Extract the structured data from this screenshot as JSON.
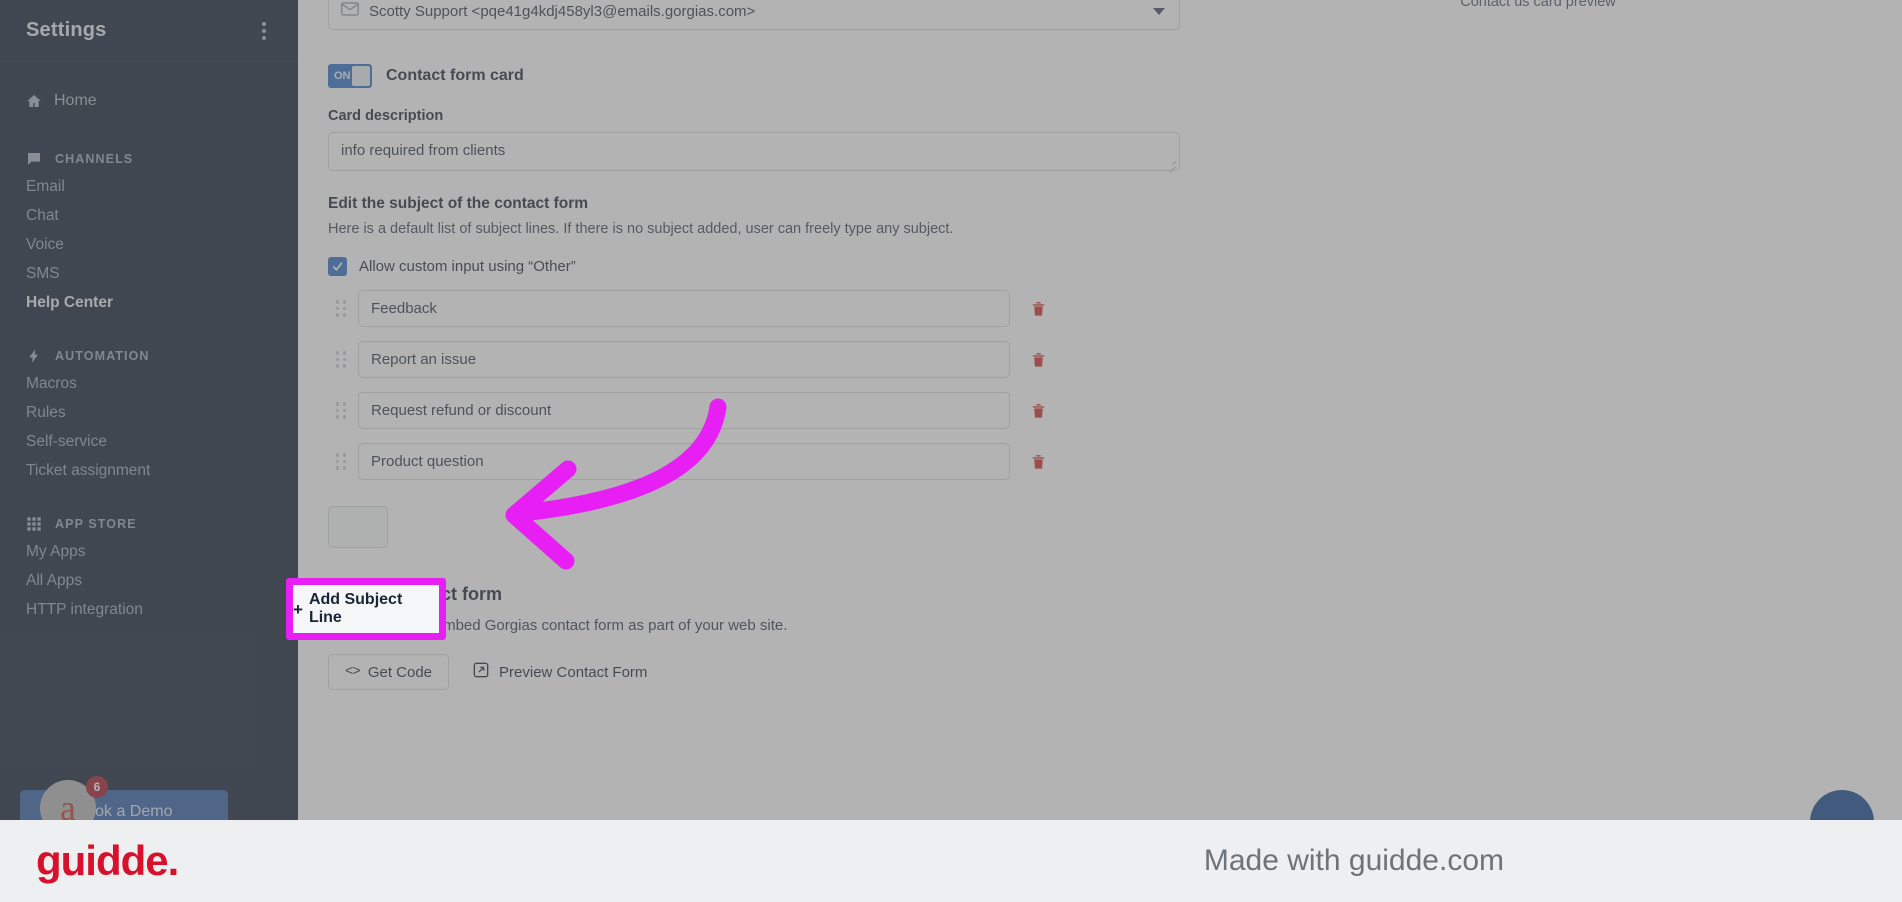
{
  "sidebar": {
    "title": "Settings",
    "menu_icon": "kebab-menu-icon",
    "home": {
      "label": "Home",
      "icon": "home-icon"
    },
    "sections": [
      {
        "label": "CHANNELS",
        "icon": "chat-bubble-icon",
        "items": [
          {
            "label": "Email",
            "active": false
          },
          {
            "label": "Chat",
            "active": false
          },
          {
            "label": "Voice",
            "active": false
          },
          {
            "label": "SMS",
            "active": false
          },
          {
            "label": "Help Center",
            "active": true
          }
        ]
      },
      {
        "label": "AUTOMATION",
        "icon": "lightning-bolt-icon",
        "items": [
          {
            "label": "Macros",
            "active": false
          },
          {
            "label": "Rules",
            "active": false
          },
          {
            "label": "Self-service",
            "active": false
          },
          {
            "label": "Ticket assignment",
            "active": false
          }
        ]
      },
      {
        "label": "APP STORE",
        "icon": "grid-icon",
        "items": [
          {
            "label": "My Apps",
            "active": false
          },
          {
            "label": "All Apps",
            "active": false
          },
          {
            "label": "HTTP integration",
            "active": false
          }
        ]
      }
    ],
    "demo_button": "Book a Demo",
    "avatar_letter": "a",
    "badge_count": "6"
  },
  "main": {
    "sender": {
      "value": "Scotty Support <pqe41g4kdj458yl3@emails.gorgias.com>",
      "icon": "envelope-icon",
      "caret": "chevron-down-icon"
    },
    "contact_form_toggle": {
      "state": "ON",
      "label": "Contact form card"
    },
    "card_description": {
      "label": "Card description",
      "value": "info required from clients"
    },
    "subject_section": {
      "heading": "Edit the subject of the contact form",
      "description": "Here is a default list of subject lines. If there is no subject added, user can freely type any subject.",
      "allow_custom_label": "Allow custom input using “Other”",
      "allow_custom_checked": true,
      "lines": [
        "Feedback",
        "Report an issue",
        "Request refund or discount",
        "Product question"
      ],
      "delete_icon": "trash-icon",
      "drag_icon": "drag-handle-icon",
      "add_button": "Add Subject Line",
      "add_button_plus": "+"
    },
    "embed": {
      "heading": "Embed contact form",
      "description": "Get the code to embed Gorgias contact form as part of your web site.",
      "get_code_label": "Get Code",
      "get_code_icon": "code-brackets-icon",
      "preview_label": "Preview Contact Form",
      "preview_icon": "external-link-icon"
    },
    "preview_panel_title": "Contact us card preview",
    "chat_fab": "chat-widget-button"
  },
  "annotation": {
    "highlight_color": "#e81ff5",
    "highlight_target": "Add Subject Line",
    "arrow": "curved-arrow-pointing-left"
  },
  "footer": {
    "brand": "guidde.",
    "made_with": "Made with guidde.com"
  }
}
